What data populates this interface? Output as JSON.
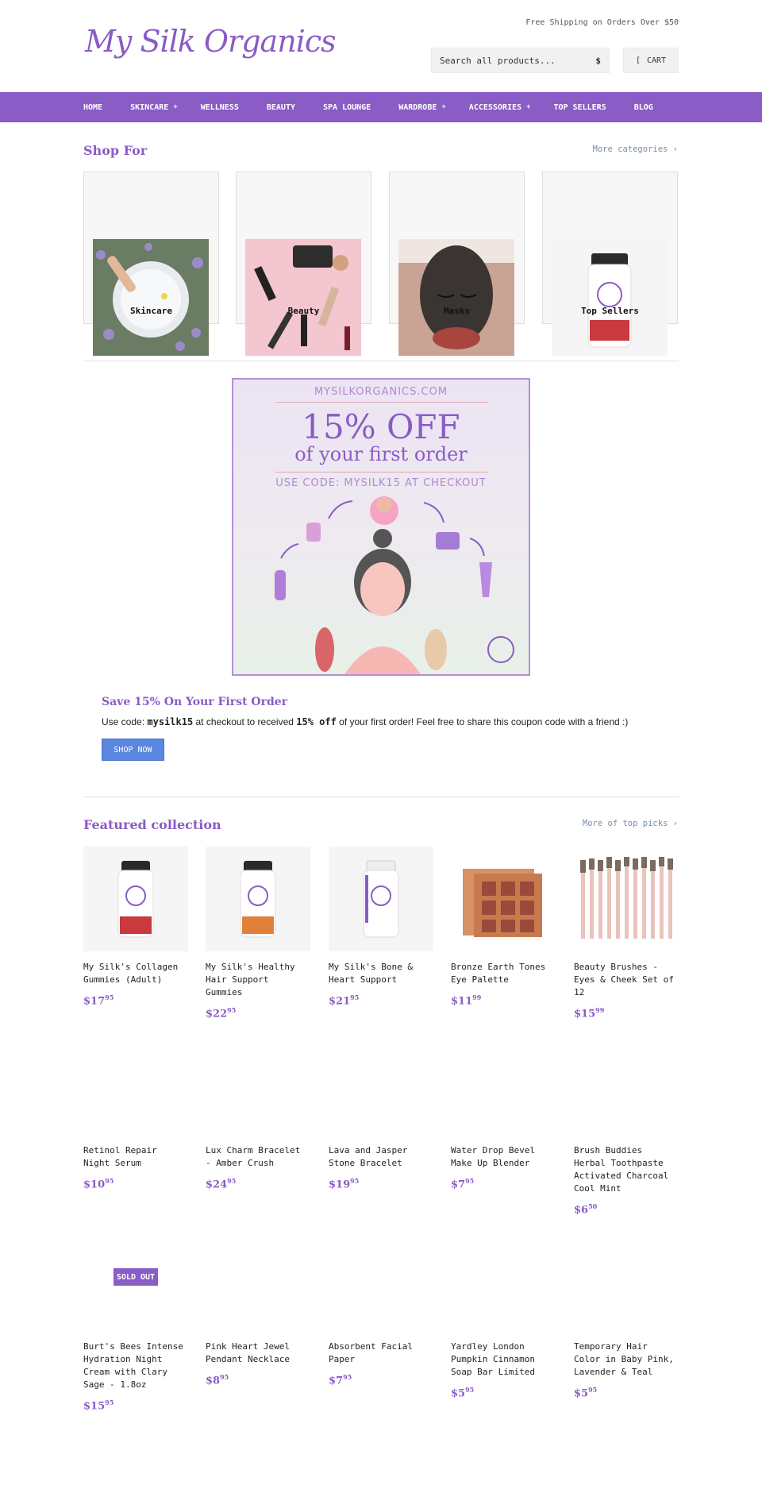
{
  "header": {
    "logo": "My Silk Organics",
    "shipping": "Free Shipping on Orders Over $50",
    "search_placeholder": "Search all products...",
    "search_icon": "$",
    "cart_icon": "[",
    "cart_label": "CART"
  },
  "nav": [
    {
      "label": "HOME",
      "caret": ""
    },
    {
      "label": "SKINCARE",
      "caret": "+"
    },
    {
      "label": "WELLNESS",
      "caret": ""
    },
    {
      "label": "BEAUTY",
      "caret": ""
    },
    {
      "label": "SPA LOUNGE",
      "caret": ""
    },
    {
      "label": "WARDROBE",
      "caret": "+"
    },
    {
      "label": "ACCESSORIES",
      "caret": "+"
    },
    {
      "label": "TOP SELLERS",
      "caret": ""
    },
    {
      "label": "BLOG",
      "caret": ""
    }
  ],
  "shop_for": {
    "title": "Shop For",
    "more": "More categories ›",
    "categories": [
      "Skincare",
      "Beauty",
      "Masks",
      "Top Sellers"
    ]
  },
  "promo": {
    "site": "MYSILKORGANICS.COM",
    "headline": "15% OFF",
    "subline": "of your first order",
    "code_line": "USE CODE: MYSILK15 AT CHECKOUT",
    "title": "Save 15% On Your First Order",
    "text_1": "Use code: ",
    "code": "mysilk15",
    "text_2": " at checkout to received ",
    "discount": "15% off",
    "text_3": " of your first order! Feel free to share this coupon code with a friend :)",
    "button": "SHOP NOW"
  },
  "featured": {
    "title": "Featured collection",
    "more": "More of top picks ›",
    "sold_out": "SOLD OUT",
    "products": [
      {
        "name": "My Silk's Collagen Gummies (Adult)",
        "dollars": "$17",
        "cents": "95"
      },
      {
        "name": "My Silk's Healthy Hair Support Gummies",
        "dollars": "$22",
        "cents": "95"
      },
      {
        "name": "My Silk's Bone & Heart Support",
        "dollars": "$21",
        "cents": "95"
      },
      {
        "name": "Bronze Earth Tones Eye Palette",
        "dollars": "$11",
        "cents": "99"
      },
      {
        "name": "Beauty Brushes - Eyes & Cheek Set of 12",
        "dollars": "$15",
        "cents": "99"
      },
      {
        "name": "Retinol Repair Night Serum",
        "dollars": "$10",
        "cents": "95"
      },
      {
        "name": "Lux Charm Bracelet - Amber Crush",
        "dollars": "$24",
        "cents": "95"
      },
      {
        "name": "Lava and Jasper Stone Bracelet",
        "dollars": "$19",
        "cents": "95"
      },
      {
        "name": "Water Drop Bevel Make Up Blender",
        "dollars": "$7",
        "cents": "95"
      },
      {
        "name": "Brush Buddies Herbal Toothpaste Activated Charcoal Cool Mint",
        "dollars": "$6",
        "cents": "50"
      },
      {
        "name": "Burt's Bees Intense Hydration Night Cream with Clary Sage - 1.8oz",
        "dollars": "$15",
        "cents": "95"
      },
      {
        "name": "Pink Heart Jewel Pendant Necklace",
        "dollars": "$8",
        "cents": "95"
      },
      {
        "name": "Absorbent Facial Paper",
        "dollars": "$7",
        "cents": "95"
      },
      {
        "name": "Yardley London Pumpkin Cinnamon Soap Bar Limited",
        "dollars": "$5",
        "cents": "95"
      },
      {
        "name": "Temporary Hair Color in Baby Pink, Lavender & Teal",
        "dollars": "$5",
        "cents": "95"
      }
    ]
  },
  "colors": {
    "brand": "#8a5cc5",
    "button": "#5b86e0"
  }
}
